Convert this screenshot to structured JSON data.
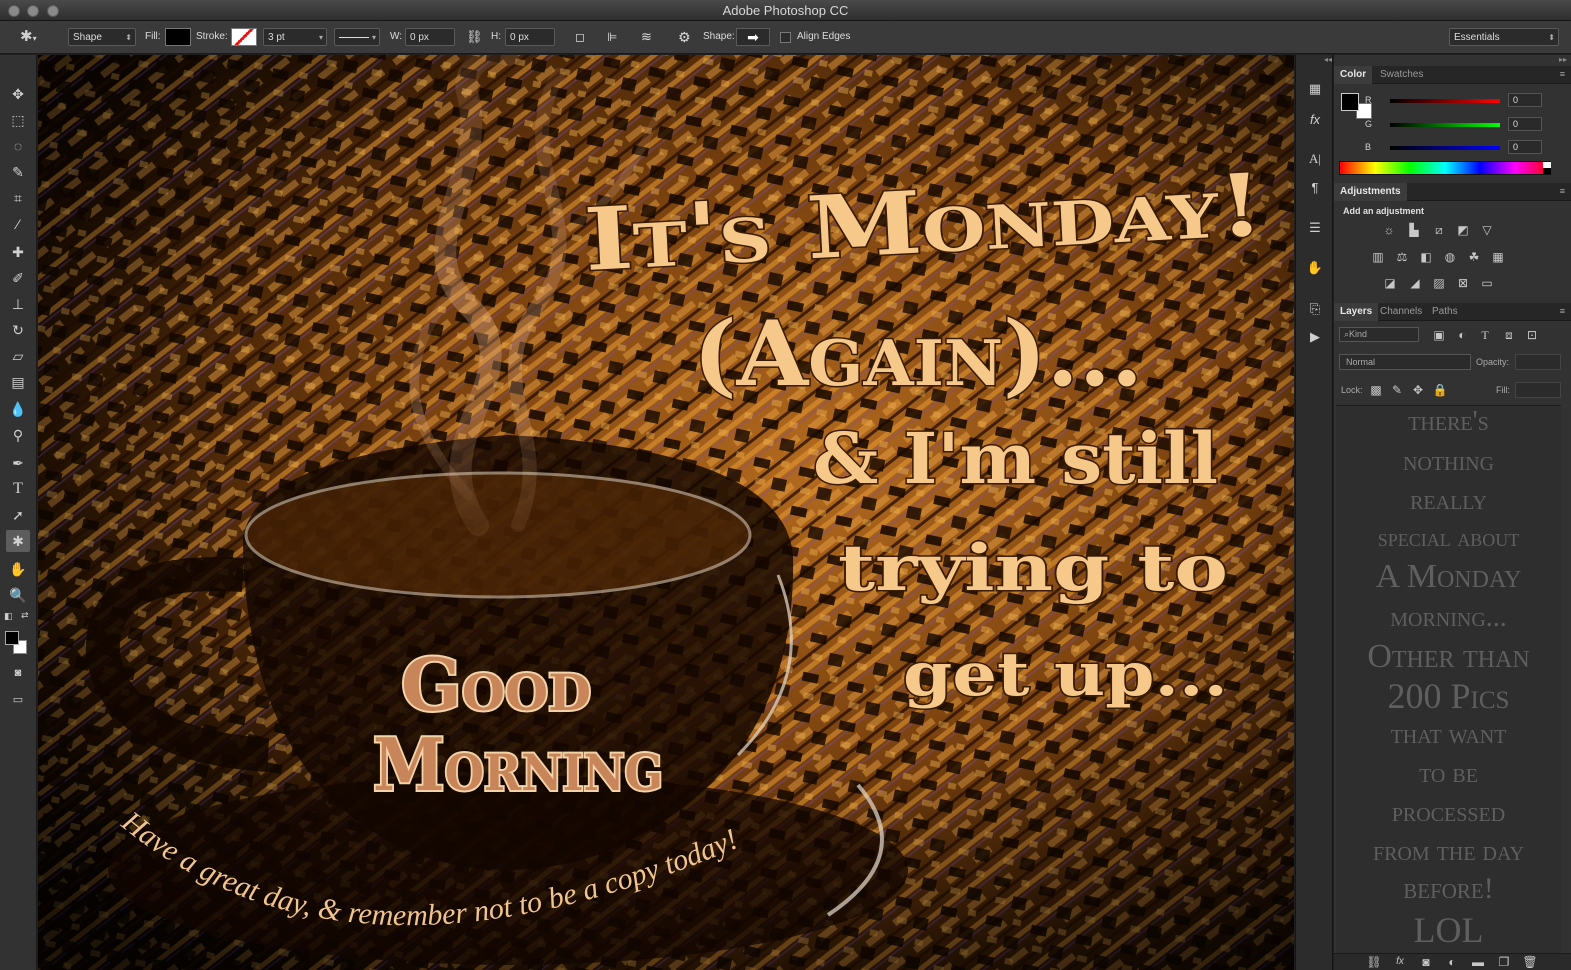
{
  "window": {
    "title": "Adobe Photoshop CC"
  },
  "options_bar": {
    "tool_mode": "Shape",
    "fill_label": "Fill:",
    "stroke_label": "Stroke:",
    "stroke_size": "3 pt",
    "w_label": "W:",
    "w_value": "0 px",
    "h_label": "H:",
    "h_value": "0 px",
    "shape_label": "Shape:",
    "align_edges_label": "Align Edges",
    "workspace": "Essentials"
  },
  "color_panel": {
    "tabs": [
      "Color",
      "Swatches"
    ],
    "r_label": "R",
    "r_value": "0",
    "g_label": "G",
    "g_value": "0",
    "b_label": "B",
    "b_value": "0"
  },
  "adjustments_panel": {
    "tab": "Adjustments",
    "heading": "Add an adjustment"
  },
  "layers_panel": {
    "tabs": [
      "Layers",
      "Channels",
      "Paths"
    ],
    "filter_kind": "Kind",
    "blend_mode": "Normal",
    "opacity_label": "Opacity:",
    "lock_label": "Lock:",
    "fill_label": "Fill:",
    "text_lines": [
      "there's",
      "nothing",
      "really",
      "special about",
      "A Monday",
      "morning...",
      "Other than",
      "200 Pics",
      "that want",
      "to be",
      "processed",
      "from the day",
      "before!",
      "LOL"
    ]
  },
  "artwork": {
    "headline_1": "It's Monday!",
    "headline_2": "(Again)...",
    "headline_3": "& I'm still",
    "headline_4": "trying to",
    "headline_5": "get up...",
    "cup_text_1": "Good",
    "cup_text_2": "Morning",
    "curved_text": "Have a great day, & remember not to be a copy today!"
  },
  "colors": {
    "accent_orange": "#f0b46a",
    "cup_text": "#c8855a",
    "canvas_dark": "#1a0c02"
  }
}
